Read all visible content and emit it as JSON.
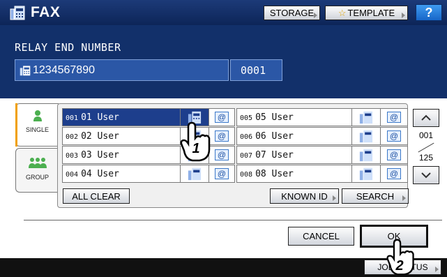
{
  "header": {
    "title": "FAX",
    "storage_label": "STORAGE",
    "template_label": "TEMPLATE",
    "help_label": "?"
  },
  "relay": {
    "label": "RELAY END NUMBER",
    "number": "1234567890",
    "end_number": "0001"
  },
  "tabs": {
    "single": "SINGLE",
    "group": "GROUP"
  },
  "entries_left": [
    {
      "idx": "001",
      "name": "01 User"
    },
    {
      "idx": "002",
      "name": "02 User"
    },
    {
      "idx": "003",
      "name": "03 User"
    },
    {
      "idx": "004",
      "name": "04 User"
    }
  ],
  "entries_right": [
    {
      "idx": "005",
      "name": "05 User"
    },
    {
      "idx": "006",
      "name": "06 User"
    },
    {
      "idx": "007",
      "name": "07 User"
    },
    {
      "idx": "008",
      "name": "08 User"
    }
  ],
  "page": {
    "current": "001",
    "total": "125"
  },
  "buttons": {
    "all_clear": "ALL CLEAR",
    "known_id": "KNOWN ID",
    "search": "SEARCH",
    "cancel": "CANCEL",
    "ok": "OK",
    "job_status": "JOB STATUS"
  },
  "callouts": {
    "step1": "1",
    "step2": "2"
  },
  "colors": {
    "header_bg": "#12306a",
    "selected_row": "#1d3e8c",
    "field_bg": "#2b57a6"
  }
}
